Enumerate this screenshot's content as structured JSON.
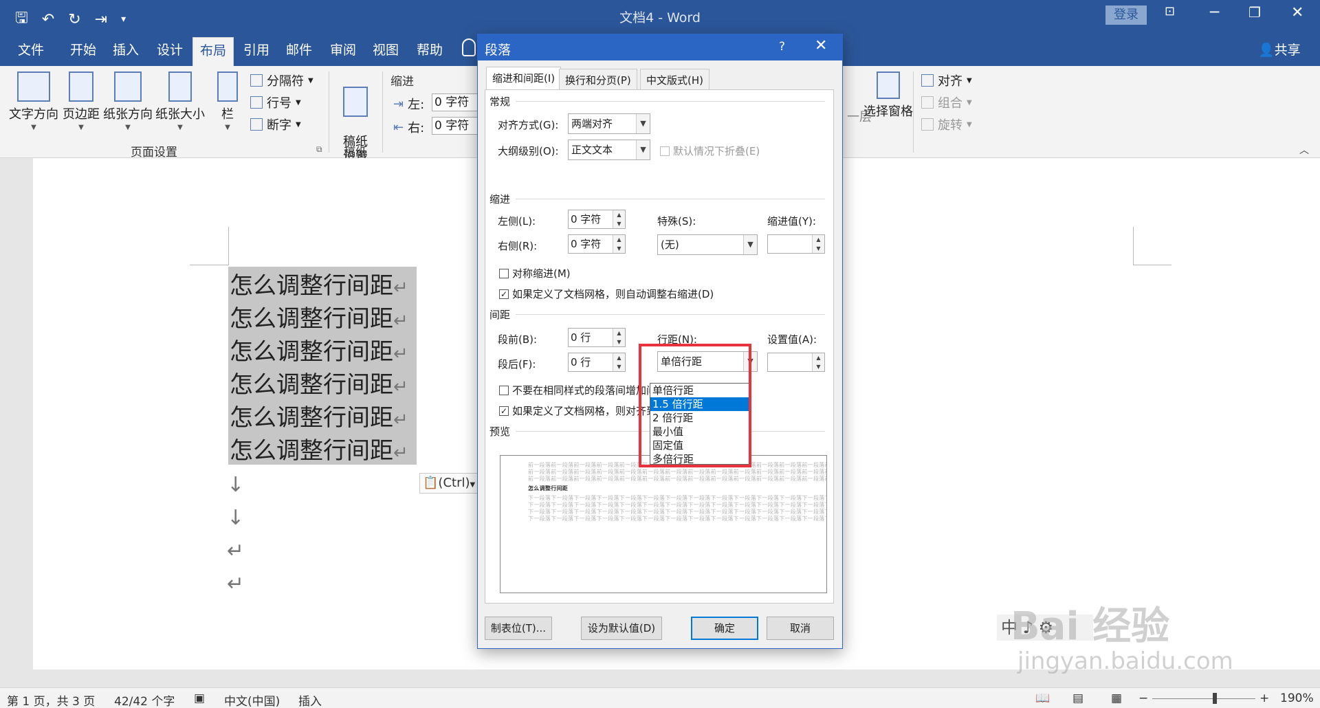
{
  "window": {
    "title": "文档4 - Word",
    "login": "登录",
    "share": "共享"
  },
  "tabs": [
    "文件",
    "开始",
    "插入",
    "设计",
    "布局",
    "引用",
    "邮件",
    "审阅",
    "视图",
    "帮助"
  ],
  "ribbon": {
    "text_direction": "文字方向",
    "margins": "页边距",
    "orientation": "纸张方向",
    "size": "纸张大小",
    "columns": "栏",
    "breaks": "分隔符",
    "line_numbers": "行号",
    "hyphenation": "断字",
    "page_setup_group": "页面设置",
    "draft_paper": "稿纸\n设置",
    "draft_group": "稿纸",
    "indent_label": "缩进",
    "indent_left_label": "左:",
    "indent_left_value": "0 字符",
    "indent_right_label": "右:",
    "indent_right_value": "0 字符",
    "layer_fragment": "一层",
    "selection_pane": "选择窗格",
    "align": "对齐",
    "group": "组合",
    "rotate": "旋转"
  },
  "document": {
    "lines": [
      "怎么调整行间距",
      "怎么调整行间距",
      "怎么调整行间距",
      "怎么调整行间距",
      "怎么调整行间距",
      "怎么调整行间距"
    ],
    "para_mark": "↵",
    "ctrl_tag": "(Ctrl)"
  },
  "dialog": {
    "title": "段落",
    "help": "?",
    "close": "✕",
    "tabs": [
      "缩进和间距(I)",
      "换行和分页(P)",
      "中文版式(H)"
    ],
    "general": {
      "section": "常规",
      "alignment_label": "对齐方式(G):",
      "alignment_value": "两端对齐",
      "outline_label": "大纲级别(O):",
      "outline_value": "正文文本",
      "collapse_label": "默认情况下折叠(E)"
    },
    "indent": {
      "section": "缩进",
      "left_label": "左侧(L):",
      "left_value": "0 字符",
      "right_label": "右侧(R):",
      "right_value": "0 字符",
      "special_label": "特殊(S):",
      "special_value": "(无)",
      "by_label": "缩进值(Y):",
      "mirror_label": "对称缩进(M)",
      "auto_adjust_label": "如果定义了文档网格，则自动调整右缩进(D)"
    },
    "spacing": {
      "section": "间距",
      "before_label": "段前(B):",
      "before_value": "0 行",
      "after_label": "段后(F):",
      "after_value": "0 行",
      "line_spacing_label": "行距(N):",
      "line_spacing_value": "单倍行距",
      "at_label": "设置值(A):",
      "no_space_label": "不要在相同样式的段落间增加间",
      "snap_grid_label": "如果定义了文档网格，则对齐到",
      "options": [
        "单倍行距",
        "1.5 倍行距",
        "2 倍行距",
        "最小值",
        "固定值",
        "多倍行距"
      ]
    },
    "preview": {
      "section": "预览",
      "prev_line": "前一段落前一段落前一段落前一段落前一段落前一段落前一段落前一段落前一段落前一段落前一段落前一段落前一段落前一段落前一段落",
      "sample": "怎么调整行间距",
      "next_line": "下一段落下一段落下一段落下一段落下一段落下一段落下一段落下一段落下一段落下一段落下一段落下一段落下一段落下一段落下一段落"
    },
    "buttons": {
      "tabs": "制表位(T)...",
      "default": "设为默认值(D)",
      "ok": "确定",
      "cancel": "取消"
    }
  },
  "status": {
    "page": "第 1 页，共 3 页",
    "words": "42/42 个字",
    "language": "中文(中国)",
    "mode": "插入",
    "zoom": "190%"
  },
  "watermark": {
    "brand": "Bai 经验",
    "url": "jingyan.baidu.com",
    "ime": "中 ♪ ⚙"
  },
  "colors": {
    "title_blue": "#2b579a",
    "dialog_blue": "#2b66c4",
    "highlight": "#0078d7",
    "annotation_red": "#e8323c"
  }
}
